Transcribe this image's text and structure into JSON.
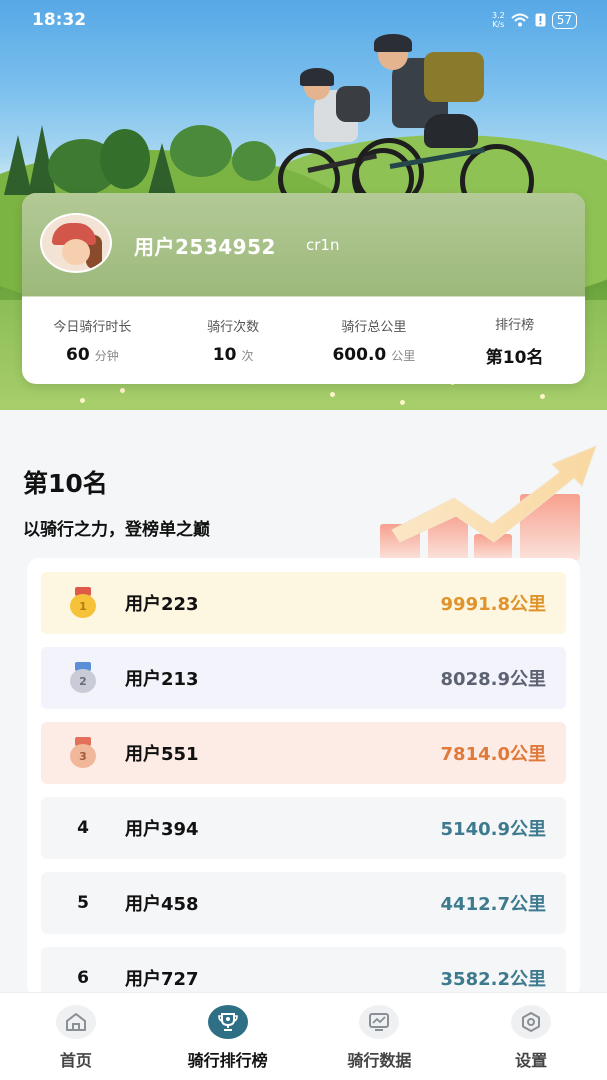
{
  "status_bar": {
    "time": "18:32",
    "net_speed_value": "3.2",
    "net_speed_unit": "K/s",
    "battery": "57"
  },
  "profile": {
    "username": "用户2534952",
    "user_id": "cr1n",
    "stats": [
      {
        "label": "今日骑行时长",
        "value": "60",
        "unit": "分钟"
      },
      {
        "label": "骑行次数",
        "value": "10",
        "unit": "次"
      },
      {
        "label": "骑行总公里",
        "value": "600.0",
        "unit": "公里"
      },
      {
        "label": "排行榜",
        "value": "第10名",
        "unit": ""
      }
    ]
  },
  "ranking": {
    "title": "第10名",
    "slogan": "以骑行之力，登榜单之巅",
    "rows": [
      {
        "rank": "1",
        "name": "用户223",
        "distance": "9991.8公里"
      },
      {
        "rank": "2",
        "name": "用户213",
        "distance": "8028.9公里"
      },
      {
        "rank": "3",
        "name": "用户551",
        "distance": "7814.0公里"
      },
      {
        "rank": "4",
        "name": "用户394",
        "distance": "5140.9公里"
      },
      {
        "rank": "5",
        "name": "用户458",
        "distance": "4412.7公里"
      },
      {
        "rank": "6",
        "name": "用户727",
        "distance": "3582.2公里"
      }
    ]
  },
  "nav": {
    "items": [
      {
        "label": "首页",
        "icon": "home-icon",
        "active": false
      },
      {
        "label": "骑行排行榜",
        "icon": "trophy-icon",
        "active": true
      },
      {
        "label": "骑行数据",
        "icon": "chart-icon",
        "active": false
      },
      {
        "label": "设置",
        "icon": "settings-icon",
        "active": false
      }
    ]
  },
  "colors": {
    "gold_row": "#fdf6e0",
    "silver_row": "#f2f3fb",
    "bronze_row": "#fdece6",
    "plain_row": "#f5f6f8",
    "gold_text": "#e0932a",
    "silver_text": "#5d6272",
    "bronze_text": "#e07a3a",
    "plain_text": "#3d7a8e",
    "nav_active": "#2e6f86"
  }
}
